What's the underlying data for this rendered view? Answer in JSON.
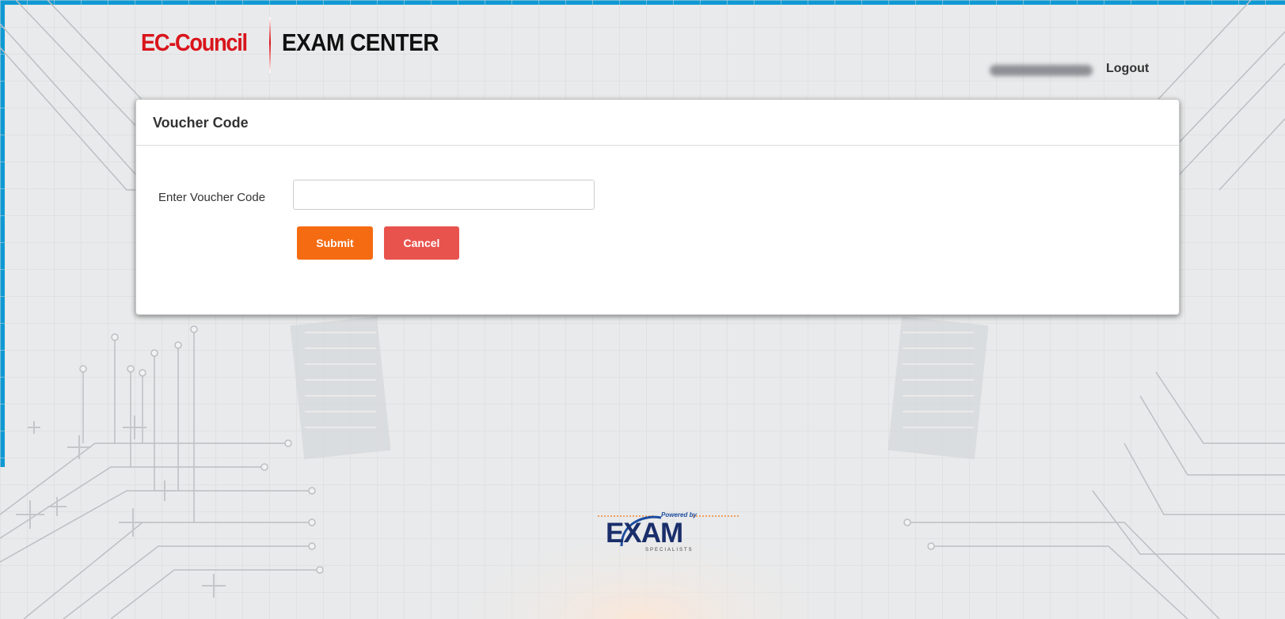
{
  "header": {
    "logo_brand": "EC-Council",
    "logo_product": "EXAM CENTER",
    "logout_label": "Logout"
  },
  "voucher": {
    "title": "Voucher Code",
    "label": "Enter Voucher Code",
    "input_value": "",
    "submit_label": "Submit",
    "cancel_label": "Cancel"
  },
  "footer": {
    "powered_by": "Powered by",
    "brand": "EXAM",
    "brand_sub": "SPECIALISTS"
  },
  "colors": {
    "frame": "#0f9ad3",
    "brand_red": "#d9151c",
    "submit": "#f56b12",
    "cancel": "#e8534e"
  }
}
